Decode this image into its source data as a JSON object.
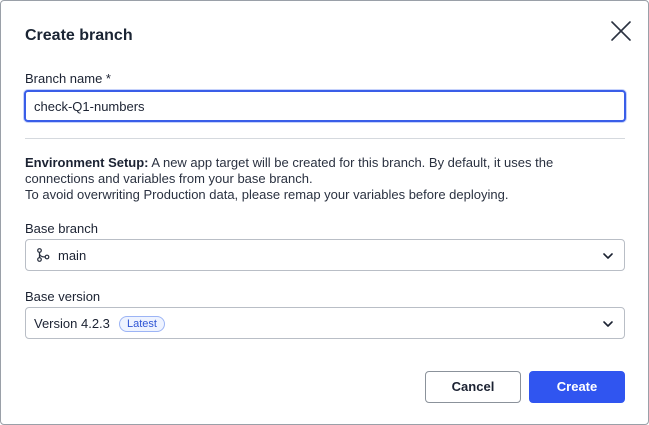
{
  "dialog": {
    "title": "Create branch"
  },
  "branch_name": {
    "label": "Branch name *",
    "value": "check-Q1-numbers"
  },
  "environment_setup": {
    "heading": "Environment Setup:",
    "line1": " A new app target will be created for this branch. By default, it uses the connections and variables from your base branch.",
    "line2": "To avoid overwriting Production data, please remap your variables before deploying."
  },
  "base_branch": {
    "label": "Base branch",
    "selected": "main",
    "icon": "git-branch-icon"
  },
  "base_version": {
    "label": "Base version",
    "selected": "Version 4.2.3",
    "badge": "Latest"
  },
  "actions": {
    "cancel_label": "Cancel",
    "create_label": "Create"
  },
  "colors": {
    "primary": "#3055f0",
    "focus_border": "#3a5ee8",
    "badge_bg": "#eef3ff",
    "badge_text": "#2f55d4"
  }
}
